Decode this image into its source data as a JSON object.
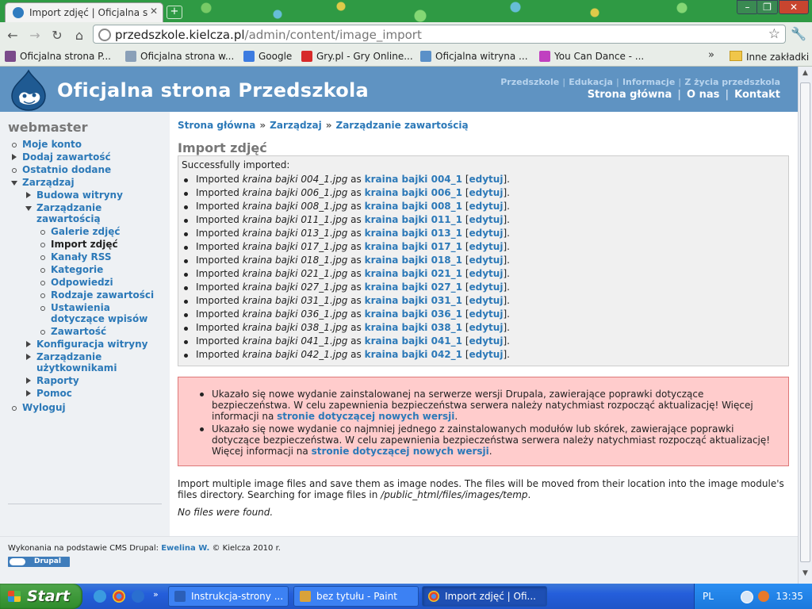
{
  "browser": {
    "tab_title": "Import zdjęć | Oficjalna s",
    "url_host": "przedszkole.kielcza.pl",
    "url_path": "/admin/content/image_import"
  },
  "bookmarks": [
    {
      "label": "Oficjalna strona P...",
      "icon": "school-icon",
      "color": "#7a4a8a"
    },
    {
      "label": "Oficjalna strona w...",
      "icon": "site-icon",
      "color": "#8aa0b8"
    },
    {
      "label": "Google",
      "icon": "google-icon",
      "color": "#3c7be0"
    },
    {
      "label": "Gry.pl - Gry Online...",
      "icon": "gry-icon",
      "color": "#d72a2a"
    },
    {
      "label": "Oficjalna witryna ...",
      "icon": "page-icon",
      "color": "#5a90c8"
    },
    {
      "label": "You Can Dance - ...",
      "icon": "star-icon",
      "color": "#c040c0"
    }
  ],
  "bookmarks_more": "»",
  "other_bookmarks": "Inne zakładki",
  "site": {
    "title": "Oficjalna strona Przedszkola",
    "secondary_links": [
      "Przedszkole",
      "Edukacja",
      "Informacje",
      "Z życia przedszkola"
    ],
    "primary_links": [
      "Strona główna",
      "O nas",
      "Kontakt"
    ]
  },
  "sidebar": {
    "title": "webmaster",
    "menu": {
      "moje_konto": "Moje konto",
      "dodaj": "Dodaj zawartość",
      "ostatnio": "Ostatnio dodane",
      "zarzadzaj": "Zarządzaj",
      "budowa": "Budowa witryny",
      "zarz_zaw": "Zarządzanie zawartością",
      "galerie": "Galerie zdjęć",
      "import": "Import zdjęć",
      "rss": "Kanały RSS",
      "kategorie": "Kategorie",
      "odpowiedzi": "Odpowiedzi",
      "rodzaje": "Rodzaje zawartości",
      "ustawienia": "Ustawienia dotyczące wpisów",
      "zawartosc": "Zawartość",
      "konfiguracja": "Konfiguracja witryny",
      "uzytkownicy": "Zarządzanie użytkownikami",
      "raporty": "Raporty",
      "pomoc": "Pomoc",
      "wyloguj": "Wyloguj"
    }
  },
  "breadcrumb": {
    "home": "Strona główna",
    "admin": "Zarządzaj",
    "current": "Zarządzanie zawartością",
    "separator": "»"
  },
  "page_title": "Import zdjęć",
  "status": {
    "heading": "Successfully imported:",
    "prefix": "Imported",
    "as": "as",
    "edit_label": "edytuj",
    "items": [
      {
        "file": "kraina bajki 004_1.jpg",
        "node": "kraina bajki 004_1"
      },
      {
        "file": "kraina bajki 006_1.jpg",
        "node": "kraina bajki 006_1"
      },
      {
        "file": "kraina bajki 008_1.jpg",
        "node": "kraina bajki 008_1"
      },
      {
        "file": "kraina bajki 011_1.jpg",
        "node": "kraina bajki 011_1"
      },
      {
        "file": "kraina bajki 013_1.jpg",
        "node": "kraina bajki 013_1"
      },
      {
        "file": "kraina bajki 017_1.jpg",
        "node": "kraina bajki 017_1"
      },
      {
        "file": "kraina bajki 018_1.jpg",
        "node": "kraina bajki 018_1"
      },
      {
        "file": "kraina bajki 021_1.jpg",
        "node": "kraina bajki 021_1"
      },
      {
        "file": "kraina bajki 027_1.jpg",
        "node": "kraina bajki 027_1"
      },
      {
        "file": "kraina bajki 031_1.jpg",
        "node": "kraina bajki 031_1"
      },
      {
        "file": "kraina bajki 036_1.jpg",
        "node": "kraina bajki 036_1"
      },
      {
        "file": "kraina bajki 038_1.jpg",
        "node": "kraina bajki 038_1"
      },
      {
        "file": "kraina bajki 041_1.jpg",
        "node": "kraina bajki 041_1"
      },
      {
        "file": "kraina bajki 042_1.jpg",
        "node": "kraina bajki 042_1"
      }
    ]
  },
  "errors": [
    {
      "text": "Ukazało się nowe wydanie zainstalowanej na serwerze wersji Drupala, zawierające poprawki dotyczące bezpieczeństwa. W celu zapewnienia bezpieczeństwa serwera należy natychmiast rozpocząć aktualizację! Więcej informacji na ",
      "link": "stronie dotyczącej nowych wersji",
      "tail": "."
    },
    {
      "text": "Ukazało się nowe wydanie co najmniej jednego z zainstalowanych modułów lub skórek, zawierające poprawki dotyczące bezpieczeństwa. W celu zapewnienia bezpieczeństwa serwera należy natychmiast rozpocząć aktualizację! Więcej informacji na ",
      "link": "stronie dotyczącej nowych wersji",
      "tail": "."
    }
  ],
  "help": {
    "text": "Import multiple image files and save them as image nodes. The files will be moved from their location into the image module's files directory. Searching for image files in ",
    "path": "/public_html/files/images/temp",
    "tail": "."
  },
  "no_files": "No files were found.",
  "footer": {
    "text": "Wykonania na podstawie CMS Drupal:",
    "author": "Ewelina W.",
    "copyright": "© Kielcza 2010 r.",
    "badge": "Drupal"
  },
  "taskbar": {
    "start": "Start",
    "quicklaunch_more": "»",
    "tasks": [
      {
        "label": "Instrukcja-strony ...",
        "icon": "word-icon",
        "color": "#2b5fb8"
      },
      {
        "label": "bez tytułu - Paint",
        "icon": "paint-icon",
        "color": "#d9a23a"
      },
      {
        "label": "Import zdjęć | Ofi...",
        "icon": "chrome-icon",
        "color": "#e04a2a"
      }
    ],
    "lang": "PL",
    "clock": "13:35"
  }
}
